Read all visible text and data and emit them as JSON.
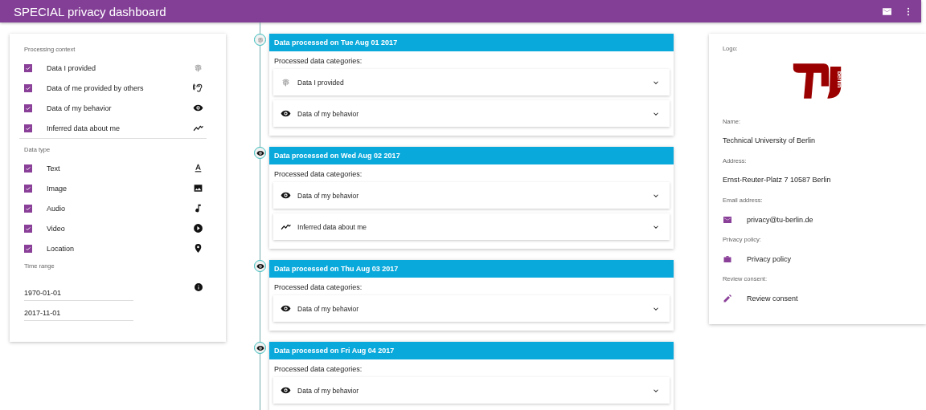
{
  "app_bar": {
    "title": "SPECIAL privacy dashboard"
  },
  "filters": {
    "processing_context": {
      "label": "Processing context",
      "items": [
        {
          "label": "Data I provided",
          "checked": true,
          "kind": "fingerprint"
        },
        {
          "label": "Data of me provided by others",
          "checked": true,
          "kind": "ear"
        },
        {
          "label": "Data of my behavior",
          "checked": true,
          "kind": "eye"
        },
        {
          "label": "Inferred data about me",
          "checked": true,
          "kind": "trend"
        }
      ]
    },
    "data_type": {
      "label": "Data type",
      "items": [
        {
          "label": "Text",
          "checked": true,
          "kind": "text"
        },
        {
          "label": "Image",
          "checked": true,
          "kind": "image"
        },
        {
          "label": "Audio",
          "checked": true,
          "kind": "audio"
        },
        {
          "label": "Video",
          "checked": true,
          "kind": "video"
        },
        {
          "label": "Location",
          "checked": true,
          "kind": "location"
        }
      ]
    },
    "time_range": {
      "label": "Time range",
      "from": "1970-01-01",
      "to": "2017-11-01"
    }
  },
  "timeline": [
    {
      "kind": "fingerprint",
      "title": "Data processed on Tue Aug 01 2017",
      "subtitle": "Processed data categories:",
      "categories": [
        {
          "label": "Data I provided",
          "kind": "fingerprint",
          "expanded": false
        },
        {
          "label": "Data of my behavior",
          "kind": "eye",
          "expanded": false
        }
      ]
    },
    {
      "kind": "eye",
      "title": "Data processed on Wed Aug 02 2017",
      "subtitle": "Processed data categories:",
      "categories": [
        {
          "label": "Data of my behavior",
          "kind": "eye",
          "expanded": false
        },
        {
          "label": "Inferred data about me",
          "kind": "trend",
          "expanded": false
        }
      ]
    },
    {
      "kind": "eye",
      "title": "Data processed on Thu Aug 03 2017",
      "subtitle": "Processed data categories:",
      "categories": [
        {
          "label": "Data of my behavior",
          "kind": "eye",
          "expanded": false
        }
      ]
    },
    {
      "kind": "eye",
      "title": "Data processed on Fri Aug 04 2017",
      "subtitle": "Processed data categories:",
      "categories": [
        {
          "label": "Data of my behavior",
          "kind": "eye",
          "expanded": false
        }
      ]
    }
  ],
  "controller": {
    "logo_label": "Logo:",
    "logo_text": "berlin",
    "name_label": "Name:",
    "name": "Technical University of Berlin",
    "address_label": "Address:",
    "address": "Ernst-Reuter-Platz 7 10587 Berlin",
    "email_label": "Email address:",
    "email": "privacy@tu-berlin.de",
    "policy_label": "Privacy policy:",
    "policy": "Privacy policy",
    "consent_label": "Review consent:",
    "consent": "Review consent"
  }
}
